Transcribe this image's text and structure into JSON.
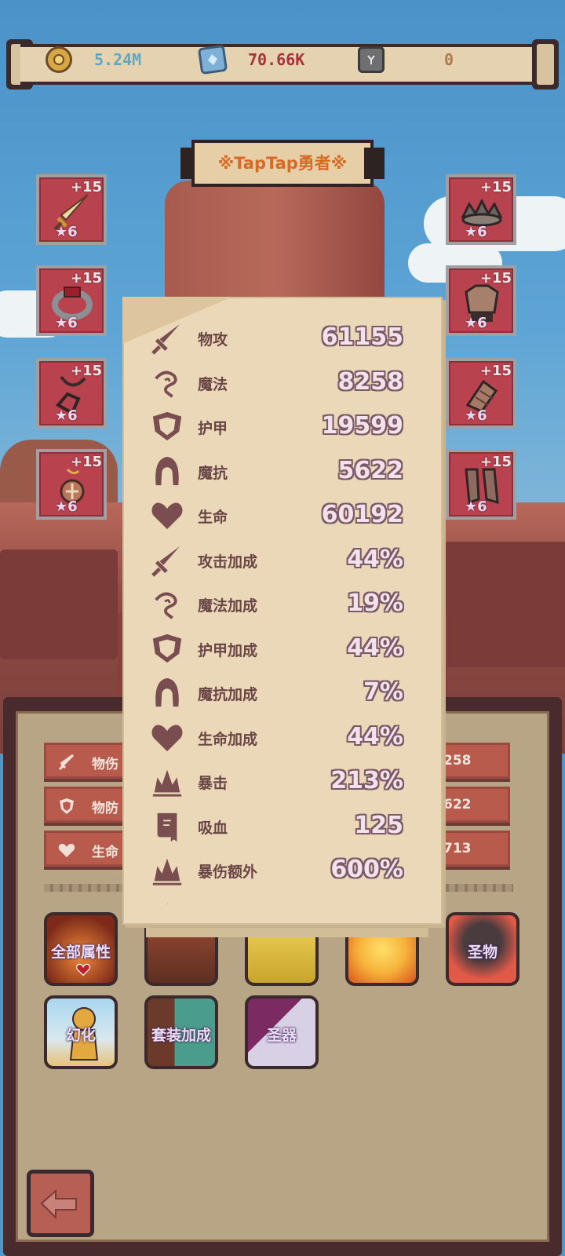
{
  "resources": [
    {
      "icon": "gold-coin-icon",
      "value": "5.24M",
      "color": "#5ea6c4"
    },
    {
      "icon": "blue-crystal-icon",
      "value": "70.66K",
      "color": "#a8323a"
    },
    {
      "icon": "dark-rune-icon",
      "value": "0",
      "color": "#b07a4a"
    }
  ],
  "hero_title": "※TapTap勇者※",
  "equipment": {
    "left": [
      {
        "name": "sword",
        "level": "+15",
        "stars": "★6"
      },
      {
        "name": "ring",
        "level": "+15",
        "stars": "★6"
      },
      {
        "name": "necklace",
        "level": "+15",
        "stars": "★6"
      },
      {
        "name": "amulet",
        "level": "+15",
        "stars": "★6"
      }
    ],
    "right": [
      {
        "name": "crown",
        "level": "+15",
        "stars": "★6"
      },
      {
        "name": "armor",
        "level": "+15",
        "stars": "★6"
      },
      {
        "name": "gloves",
        "level": "+15",
        "stars": "★6"
      },
      {
        "name": "boots",
        "level": "+15",
        "stars": "★6"
      }
    ]
  },
  "panel_stats": [
    {
      "icon": "sword-icon",
      "label": "物伤",
      "value": "258"
    },
    {
      "icon": "shield-icon",
      "label": "物防",
      "value": "622"
    },
    {
      "icon": "heart-icon",
      "label": "生命",
      "value": "713"
    }
  ],
  "function_buttons": {
    "row1": [
      {
        "label": "全部属性",
        "colors": [
          "#e8632a",
          "#7d2a1a"
        ]
      },
      {
        "label": "",
        "colors": [
          "#9a4b33",
          "#5e2f22"
        ]
      },
      {
        "label": "",
        "colors": [
          "#e0c44a",
          "#c9a42c"
        ]
      },
      {
        "label": "",
        "colors": [
          "#f6b23a",
          "#d8551f"
        ]
      },
      {
        "label": "圣物",
        "colors": [
          "#e15a48",
          "#4a3b3e"
        ]
      }
    ],
    "row2": [
      {
        "label": "幻化",
        "colors": [
          "#a9d6ef",
          "#e7c27a"
        ]
      },
      {
        "label": "套装加成",
        "colors": [
          "#4a9d8c",
          "#6b3a2a"
        ]
      },
      {
        "label": "圣器",
        "colors": [
          "#7b2a62",
          "#d8d0e4"
        ]
      }
    ]
  },
  "popup_stats": [
    {
      "icon": "sword-icon",
      "name": "物攻",
      "value": "61155"
    },
    {
      "icon": "magic-swirl-icon",
      "name": "魔法",
      "value": "8258"
    },
    {
      "icon": "shield-icon",
      "name": "护甲",
      "value": "19599"
    },
    {
      "icon": "hood-icon",
      "name": "魔抗",
      "value": "5622"
    },
    {
      "icon": "heart-icon",
      "name": "生命",
      "value": "60192"
    },
    {
      "icon": "sword-icon",
      "name": "攻击加成",
      "value": "44%"
    },
    {
      "icon": "magic-swirl-icon",
      "name": "魔法加成",
      "value": "19%"
    },
    {
      "icon": "shield-icon",
      "name": "护甲加成",
      "value": "44%"
    },
    {
      "icon": "hood-icon",
      "name": "魔抗加成",
      "value": "7%"
    },
    {
      "icon": "heart-icon",
      "name": "生命加成",
      "value": "44%"
    },
    {
      "icon": "crit-burst-icon",
      "name": "暴击",
      "value": "213%"
    },
    {
      "icon": "lifesteal-book-icon",
      "name": "吸血",
      "value": "125"
    },
    {
      "icon": "crit-burst-icon",
      "name": "暴伤额外",
      "value": "600%"
    },
    {
      "icon": "crit-burst-icon",
      "name": "",
      "value": ""
    }
  ],
  "back_button": {
    "icon": "back-arrow-icon"
  }
}
